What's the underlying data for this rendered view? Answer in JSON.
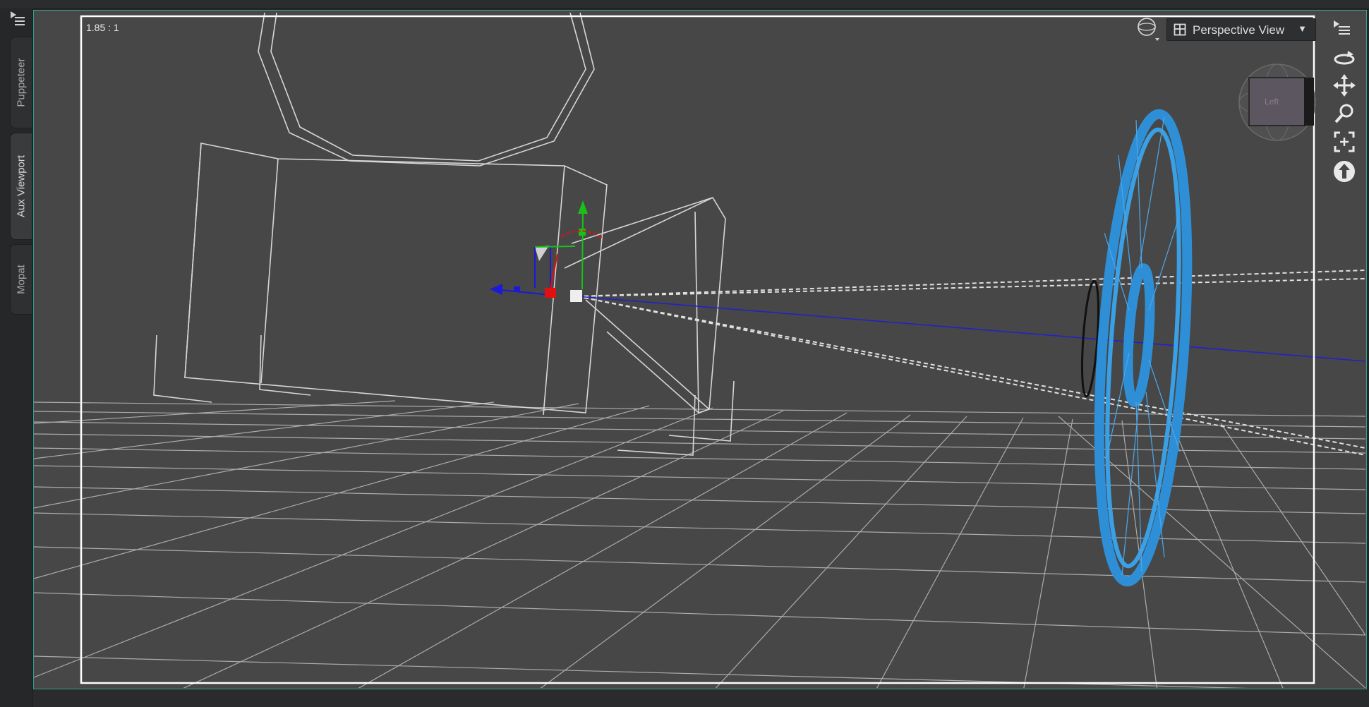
{
  "tabs": [
    {
      "label": "Puppeteer",
      "active": false
    },
    {
      "label": "Aux Viewport",
      "active": true
    },
    {
      "label": "Mopat",
      "active": false
    }
  ],
  "viewport": {
    "aspect_ratio_label": "1.85 : 1",
    "view_selector": "Perspective View",
    "view_selector_arrow": "▼",
    "cube_face_label": "Left"
  },
  "colors": {
    "frame_border": "#35a28e",
    "viewport_bg": "#474747",
    "wireframe": "#d0d0d0",
    "light_mesh": "#2e8fd6",
    "gizmo_x": "#e01010",
    "gizmo_y": "#18c018",
    "gizmo_z": "#1a1ad8"
  },
  "tools": [
    "orbit-icon",
    "pan-icon",
    "zoom-icon",
    "frame-icon",
    "reset-view-icon"
  ]
}
